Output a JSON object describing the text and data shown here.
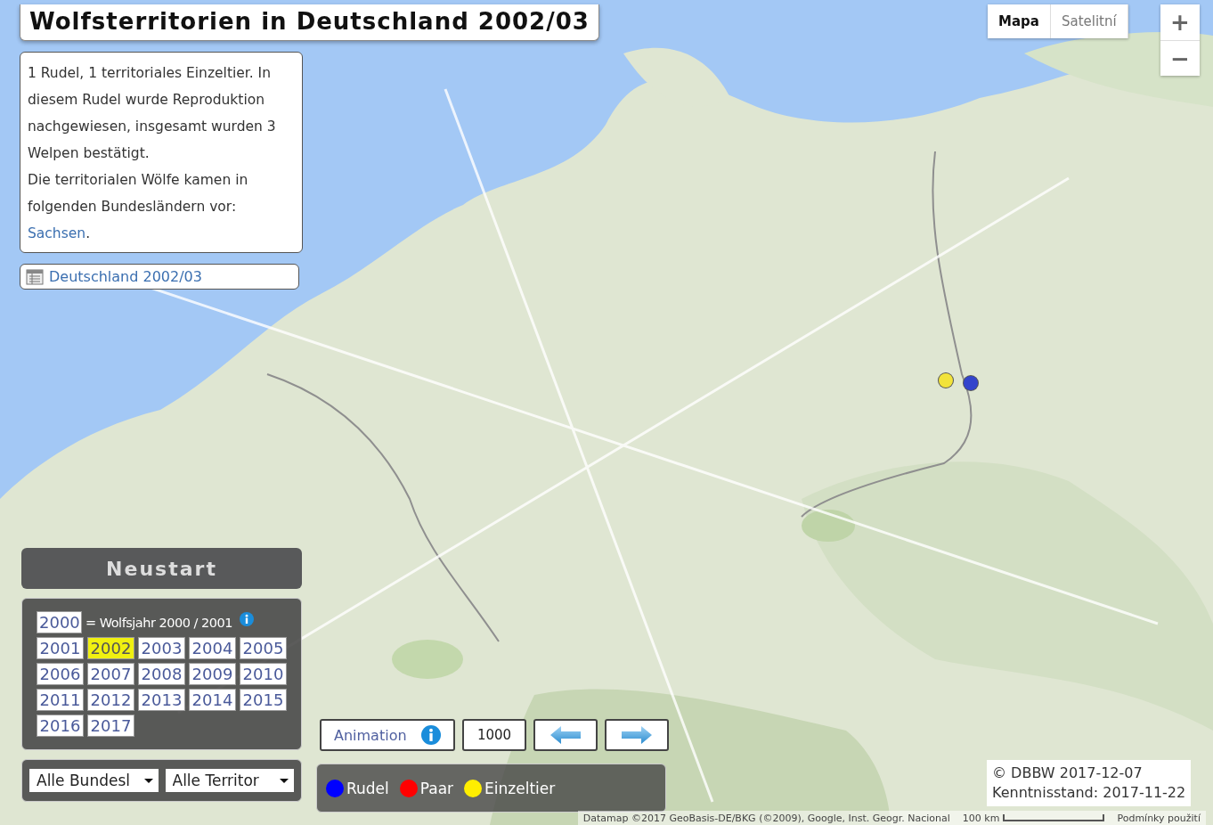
{
  "title": "Wolfsterritorien in Deutschland 2002/03",
  "info": {
    "paragraphs": [
      "1 Rudel, 1 territoriales Einzeltier. In diesem Rudel wurde Reproduktion nachgewiesen, insgesamt wurden 3 Welpen bestätigt.",
      "Die territorialen Wölfe kamen in folgenden Bundesländern vor:"
    ],
    "link": "Sachsen",
    "after": "."
  },
  "table_link": "Deutschland 2002/03",
  "map": {
    "kind": "picture"
  },
  "markers": [
    {
      "color": "#f2e33a"
    },
    {
      "color": "#3344cc"
    }
  ],
  "map_type": [
    {
      "label": "Mapa",
      "selected": true
    },
    {
      "label": "Satelitní",
      "selected": false
    }
  ],
  "zoom": [
    "+",
    "−"
  ],
  "restart": "Neustart",
  "years": {
    "first": "2000",
    "legend": "= Wolfsjahr 2000 / 2001",
    "items": [
      {
        "label": "2001",
        "selected": false
      },
      {
        "label": "2002",
        "selected": true
      },
      {
        "label": "2003",
        "selected": false
      },
      {
        "label": "2004",
        "selected": false
      },
      {
        "label": "2005",
        "selected": false
      },
      {
        "label": "2006",
        "selected": false
      },
      {
        "label": "2007",
        "selected": false
      },
      {
        "label": "2008",
        "selected": false
      },
      {
        "label": "2009",
        "selected": false
      },
      {
        "label": "2010",
        "selected": false
      },
      {
        "label": "2011",
        "selected": false
      },
      {
        "label": "2012",
        "selected": false
      },
      {
        "label": "2013",
        "selected": false
      },
      {
        "label": "2014",
        "selected": false
      },
      {
        "label": "2015",
        "selected": false
      },
      {
        "label": "2016",
        "selected": false
      },
      {
        "label": "2017",
        "selected": false
      }
    ]
  },
  "filters": [
    {
      "value": "Alle Bundesl"
    },
    {
      "value": "Alle Territor"
    }
  ],
  "animation": {
    "label": "Animation",
    "interval": "1000"
  },
  "legend": [
    {
      "label": "Rudel",
      "color": "#0000ff"
    },
    {
      "label": "Paar",
      "color": "#ff0000"
    },
    {
      "label": "Einzeltier",
      "color": "#ffee00"
    }
  ],
  "copyright": [
    "© DBBW 2017-12-07",
    "Kenntnisstand: 2017-11-22"
  ],
  "attribution": "Datamap ©2017 GeoBasis-DE/BKG (©2009), Google, Inst. Geogr. Nacional",
  "scale": "100 km",
  "terms": "Podmínky použití"
}
